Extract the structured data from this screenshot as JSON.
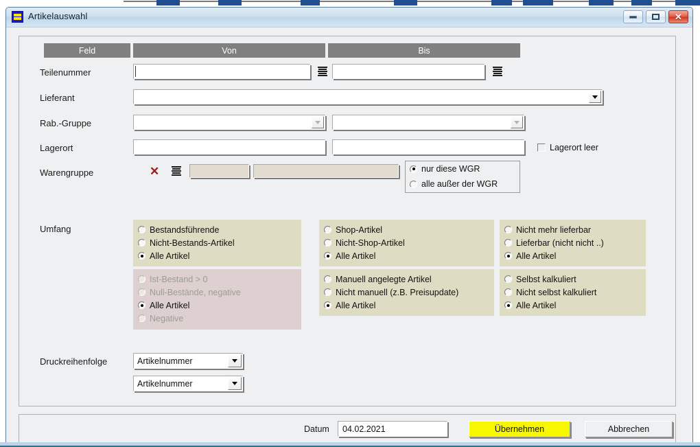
{
  "window": {
    "title": "Artikelauswahl",
    "icon": "list-document-icon",
    "buttons": {
      "minimize": "–",
      "maximize": "❐",
      "close": "✕"
    }
  },
  "columns": {
    "feld": "Feld",
    "von": "Von",
    "bis": "Bis"
  },
  "rows": {
    "teilenummer": {
      "label": "Teilenummer",
      "von_value": "",
      "bis_value": ""
    },
    "lieferant": {
      "label": "Lieferant",
      "value": ""
    },
    "rabgruppe": {
      "label": "Rab.-Gruppe",
      "von_value": "",
      "bis_value": ""
    },
    "lagerort": {
      "label": "Lagerort",
      "von_value": "",
      "bis_value": "",
      "empty_checkbox": "Lagerort leer",
      "empty_checked": false
    },
    "warengruppe": {
      "label": "Warengruppe",
      "von_value": "",
      "bis_value": ""
    }
  },
  "wgr_mode": {
    "options": [
      "nur diese WGR",
      "alle außer der WGR"
    ],
    "selected": 0
  },
  "umfang": {
    "label": "Umfang",
    "groups": [
      {
        "name": "bestand-group",
        "style": "khaki",
        "options": [
          "Bestandsführende",
          "Nicht-Bestands-Artikel",
          "Alle Artikel"
        ],
        "selected": 2,
        "disabled": false
      },
      {
        "name": "shop-group",
        "style": "khaki",
        "options": [
          "Shop-Artikel",
          "Nicht-Shop-Artikel",
          "Alle Artikel"
        ],
        "selected": 2,
        "disabled": false
      },
      {
        "name": "lieferbar-group",
        "style": "khaki",
        "options": [
          "Nicht mehr lieferbar",
          "Lieferbar (nicht nicht ..)",
          "Alle Artikel"
        ],
        "selected": 2,
        "disabled": false
      },
      {
        "name": "ist-bestand-group",
        "style": "pink",
        "options": [
          "Ist-Bestand > 0",
          "Null-Bestände, negative",
          "Alle Artikel",
          "Negative"
        ],
        "selected": 2,
        "disabled": true
      },
      {
        "name": "manuell-group",
        "style": "khaki",
        "options": [
          "Manuell angelegte Artikel",
          "Nicht manuell (z.B. Preisupdate)",
          "Alle Artikel"
        ],
        "selected": 2,
        "disabled": false
      },
      {
        "name": "kalkuliert-group",
        "style": "khaki",
        "options": [
          "Selbst kalkuliert",
          "Nicht selbst kalkuliert",
          "Alle Artikel"
        ],
        "selected": 2,
        "disabled": false
      }
    ]
  },
  "druckreihenfolge": {
    "label": "Druckreihenfolge",
    "first_value": "Artikelnummer",
    "second_value": "Artikelnummer"
  },
  "footer": {
    "datum_label": "Datum",
    "datum_value": "04.02.2021",
    "submit_label": "Übernehmen",
    "cancel_label": "Abbrechen"
  }
}
